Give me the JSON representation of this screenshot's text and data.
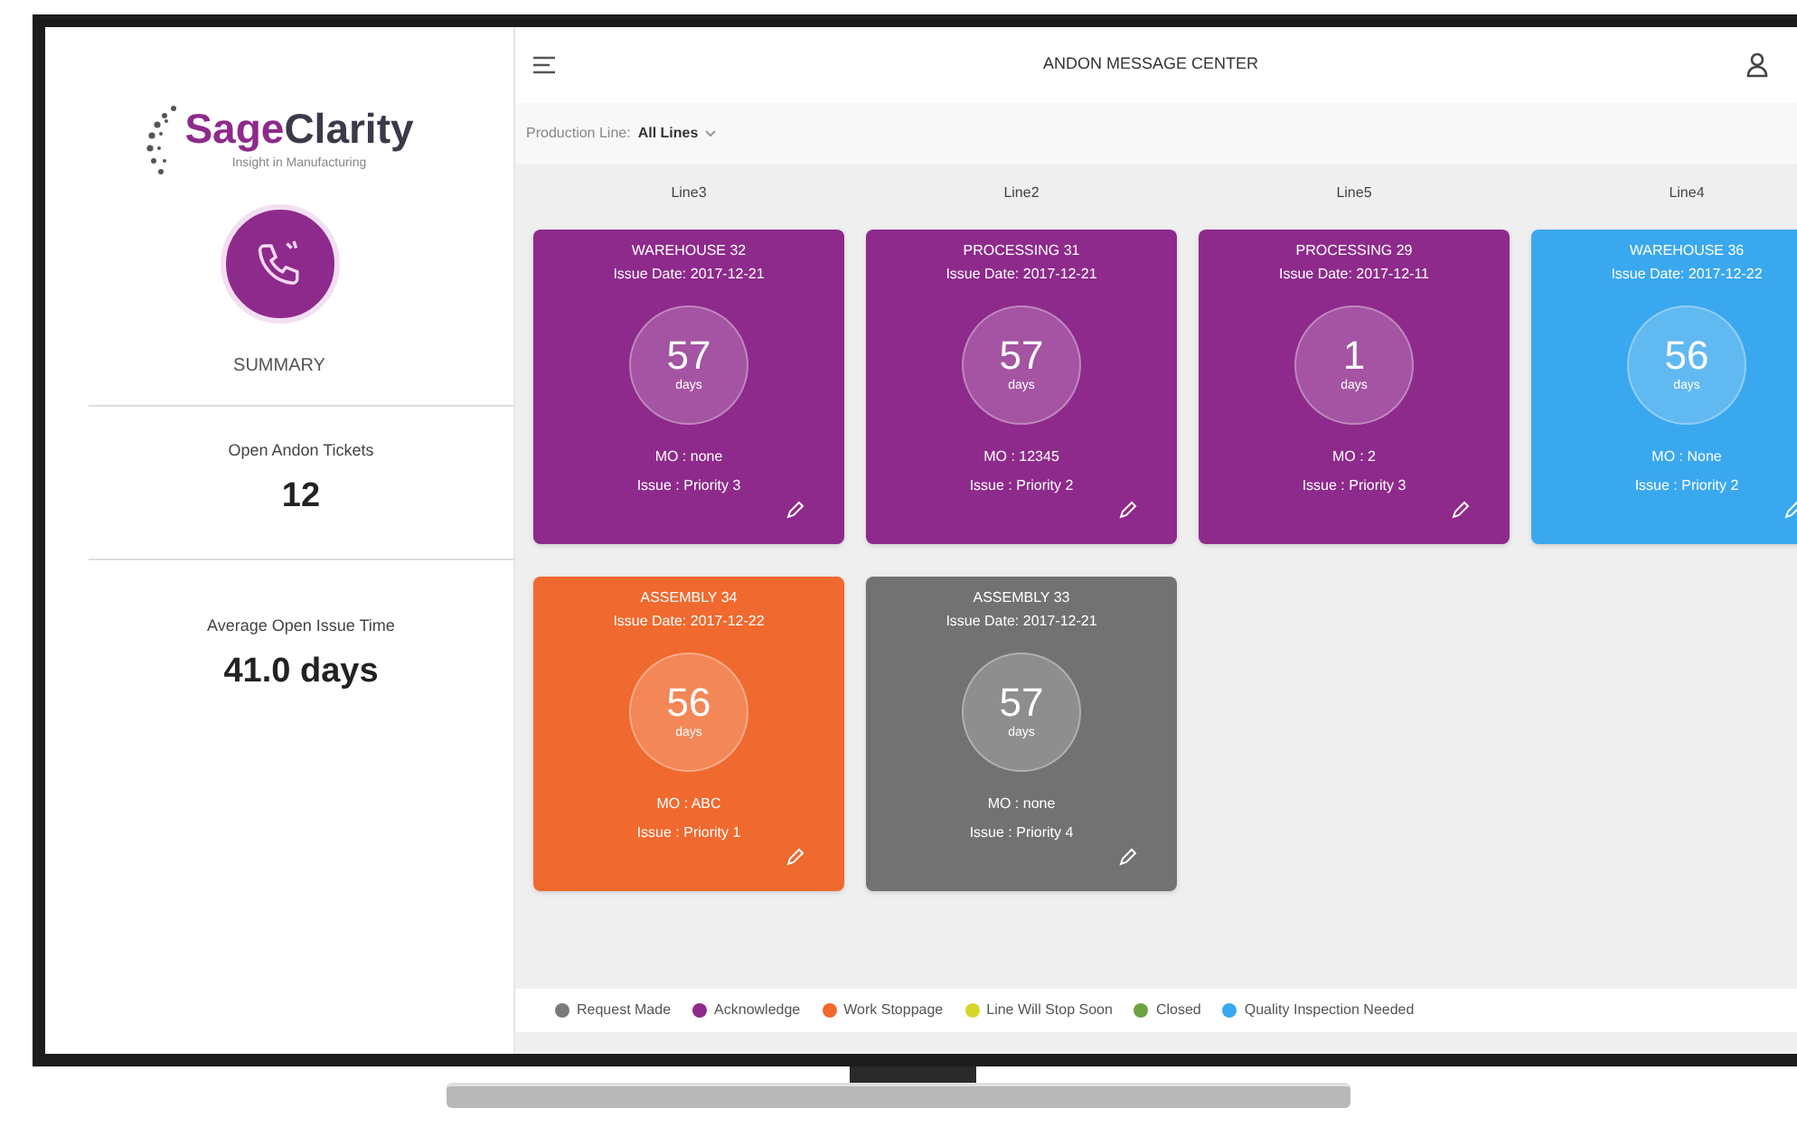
{
  "logo": {
    "name_first": "Sage",
    "name_rest": "Clarity",
    "tagline": "Insight in Manufacturing"
  },
  "sidebar": {
    "heading": "SUMMARY",
    "stats": [
      {
        "label": "Open Andon Tickets",
        "value": "12"
      },
      {
        "label": "Average Open Issue Time",
        "value": "41.0 days"
      }
    ]
  },
  "header": {
    "title": "ANDON MESSAGE CENTER"
  },
  "filter": {
    "label": "Production Line:",
    "value": "All Lines"
  },
  "lines": [
    {
      "name": "Line3",
      "cards": [
        {
          "title": "WAREHOUSE 32",
          "issue_date": "Issue Date: 2017-12-21",
          "days": "57",
          "unit": "days",
          "mo": "MO : none",
          "issue": "Issue : Priority 3",
          "color": "#8e2a8b"
        },
        {
          "title": "ASSEMBLY 34",
          "issue_date": "Issue Date: 2017-12-22",
          "days": "56",
          "unit": "days",
          "mo": "MO : ABC",
          "issue": "Issue : Priority 1",
          "color": "#f0692e"
        }
      ]
    },
    {
      "name": "Line2",
      "cards": [
        {
          "title": "PROCESSING 31",
          "issue_date": "Issue Date: 2017-12-21",
          "days": "57",
          "unit": "days",
          "mo": "MO : 12345",
          "issue": "Issue : Priority 2",
          "color": "#8e2a8b"
        },
        {
          "title": "ASSEMBLY 33",
          "issue_date": "Issue Date: 2017-12-21",
          "days": "57",
          "unit": "days",
          "mo": "MO : none",
          "issue": "Issue : Priority 4",
          "color": "#727272"
        }
      ]
    },
    {
      "name": "Line5",
      "cards": [
        {
          "title": "PROCESSING 29",
          "issue_date": "Issue Date: 2017-12-11",
          "days": "1",
          "unit": "days",
          "mo": "MO : 2",
          "issue": "Issue : Priority 3",
          "color": "#8e2a8b"
        }
      ]
    },
    {
      "name": "Line4",
      "cards": [
        {
          "title": "WAREHOUSE 36",
          "issue_date": "Issue Date: 2017-12-22",
          "days": "56",
          "unit": "days",
          "mo": "MO : None",
          "issue": "Issue : Priority 2",
          "color": "#3aa8ef"
        }
      ]
    }
  ],
  "legend": [
    {
      "label": "Request Made",
      "color": "#7a7a7a"
    },
    {
      "label": "Acknowledge",
      "color": "#8e2a8b"
    },
    {
      "label": "Work Stoppage",
      "color": "#f0692e"
    },
    {
      "label": "Line Will Stop Soon",
      "color": "#d4d62a"
    },
    {
      "label": "Closed",
      "color": "#6ca33f"
    },
    {
      "label": "Quality Inspection Needed",
      "color": "#3aa8ef"
    }
  ]
}
